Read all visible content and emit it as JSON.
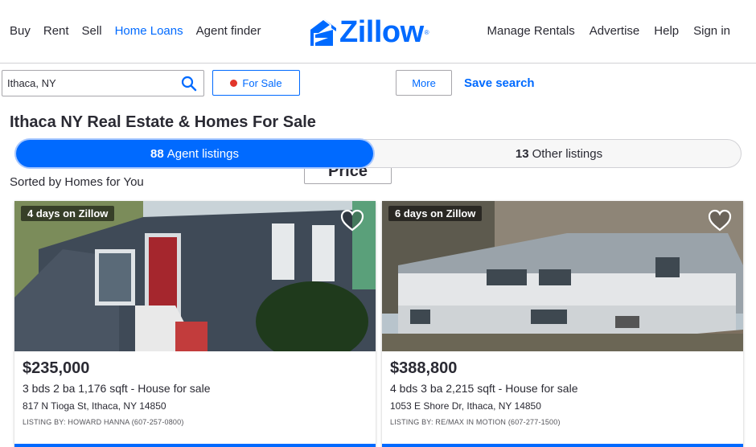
{
  "header": {
    "nav_left": [
      "Buy",
      "Rent",
      "Sell",
      "Home Loans",
      "Agent finder"
    ],
    "nav_right": [
      "Manage Rentals",
      "Advertise",
      "Help",
      "Sign in"
    ],
    "logo_text": "Zillow",
    "brand_color": "#006aff"
  },
  "search": {
    "value": "Ithaca, NY",
    "icon": "search-icon"
  },
  "filters": {
    "for_sale": "For Sale",
    "price": "Price",
    "more": "More",
    "save_search": "Save search"
  },
  "page_title": "Ithaca NY Real Estate & Homes For Sale",
  "toggle": {
    "agent_count": "88",
    "agent_label": "Agent listings",
    "other_count": "13",
    "other_label": "Other listings"
  },
  "sorted_label": "Sorted by Homes for You",
  "listings": [
    {
      "days": "4 days on Zillow",
      "price": "$235,000",
      "details": "3 bds  2 ba  1,176 sqft  - House for sale",
      "address": "817 N Tioga St, Ithaca, NY 14850",
      "listing_by": "LISTING BY: HOWARD HANNA (607-257-0800)"
    },
    {
      "days": "6 days on Zillow",
      "price": "$388,800",
      "details": "4 bds  3 ba  2,215 sqft  - House for sale",
      "address": "1053 E Shore Dr, Ithaca, NY 14850",
      "listing_by": "LISTING BY: RE/MAX IN MOTION (607-277-1500)"
    }
  ]
}
